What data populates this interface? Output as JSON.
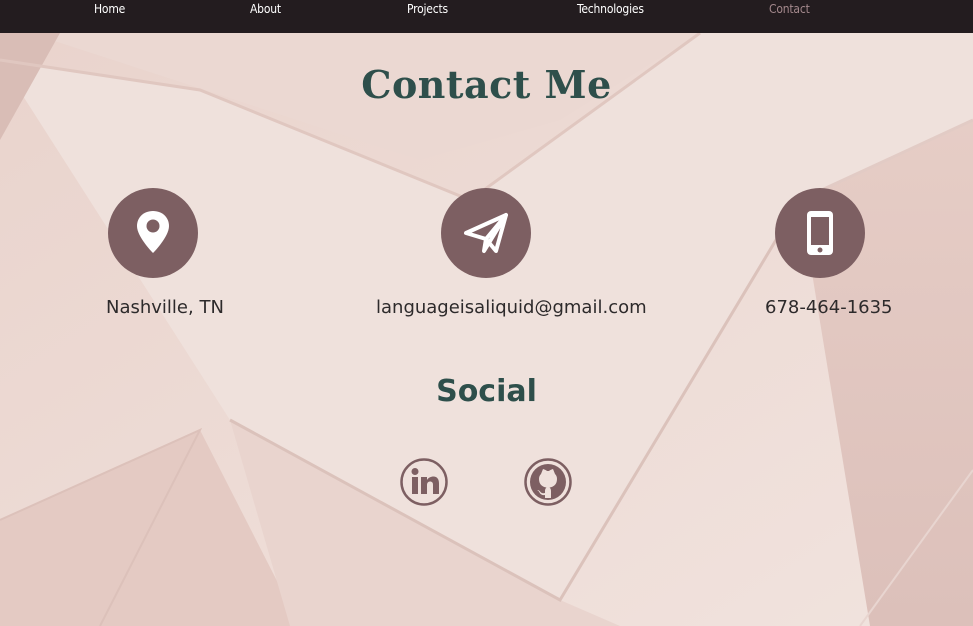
{
  "nav": {
    "items": [
      {
        "label": "Home"
      },
      {
        "label": "About"
      },
      {
        "label": "Projects"
      },
      {
        "label": "Technologies"
      },
      {
        "label": "Contact"
      }
    ]
  },
  "contact": {
    "title": "Contact Me",
    "location": {
      "text": "Nashville, TN",
      "icon": "map-pin-icon"
    },
    "email": {
      "text": "languageisaliquid@gmail.com",
      "icon": "paper-plane-icon"
    },
    "phone": {
      "text": "678-464-1635",
      "icon": "mobile-phone-icon"
    }
  },
  "social": {
    "title": "Social",
    "links": [
      {
        "icon": "linkedin-icon"
      },
      {
        "icon": "github-icon"
      }
    ]
  },
  "colors": {
    "nav_bg": "#231c1f",
    "accent_circle": "#7d5f62",
    "heading": "#2e4f4b",
    "active_nav": "#a3888c"
  }
}
